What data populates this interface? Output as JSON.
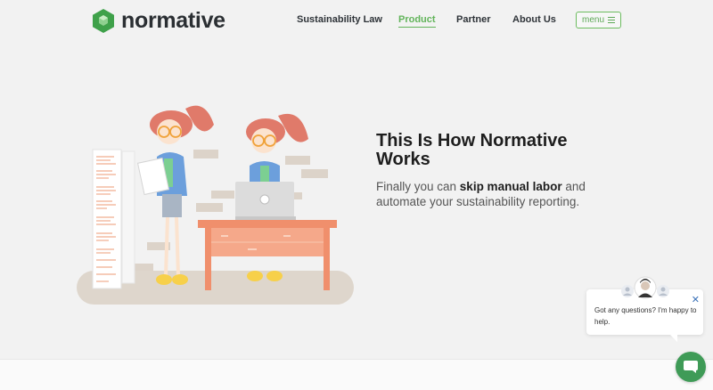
{
  "brand": {
    "name": "normative",
    "color": "#3fa14a"
  },
  "nav": {
    "links": [
      {
        "label": "Sustainability Law",
        "active": false
      },
      {
        "label": "Product",
        "active": true
      },
      {
        "label": "Partner",
        "active": false
      },
      {
        "label": "About Us",
        "active": false
      }
    ],
    "menu_label": "menu"
  },
  "hero": {
    "title": "This Is How Normative Works",
    "sub_before": "Finally you can ",
    "sub_bold": "skip manual labor",
    "sub_after": " and automate your sustainability reporting."
  },
  "chat": {
    "message": "Got any questions? I'm happy to help.",
    "close_icon": "close-icon",
    "launcher_icon": "chat-bubble-icon",
    "color": "#3f9b57"
  },
  "colors": {
    "accent": "#62b45a",
    "desk": "#ef8c6a",
    "hair": "#e07a6a"
  }
}
